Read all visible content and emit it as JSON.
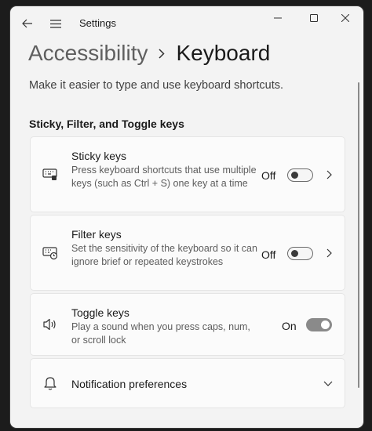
{
  "window": {
    "title": "Settings"
  },
  "breadcrumb": {
    "parent": "Accessibility",
    "current": "Keyboard"
  },
  "description": "Make it easier to type and use keyboard shortcuts.",
  "section": {
    "title": "Sticky, Filter, and Toggle keys"
  },
  "settings": [
    {
      "title": "Sticky keys",
      "description": "Press keyboard shortcuts that use multiple keys (such as Ctrl + S) one key at a time",
      "state": "Off",
      "enabled": false
    },
    {
      "title": "Filter keys",
      "description": "Set the sensitivity of the keyboard so it can ignore brief or repeated keystrokes",
      "state": "Off",
      "enabled": false
    },
    {
      "title": "Toggle keys",
      "description": "Play a sound when you press caps, num, or scroll lock",
      "state": "On",
      "enabled": true
    }
  ],
  "notifications": {
    "label": "Notification preferences"
  },
  "icons": {
    "back": "back-arrow-icon",
    "menu": "hamburger-menu-icon",
    "minimize": "minimize-icon",
    "maximize": "maximize-icon",
    "close": "close-icon",
    "sticky": "sticky-keys-icon",
    "filter": "filter-keys-icon",
    "toggle": "speaker-icon",
    "notification": "bell-icon"
  },
  "colors": {
    "window_bg": "#f3f3f3",
    "card_bg": "#fbfbfb",
    "toggle_on": "#8a8a8a"
  }
}
